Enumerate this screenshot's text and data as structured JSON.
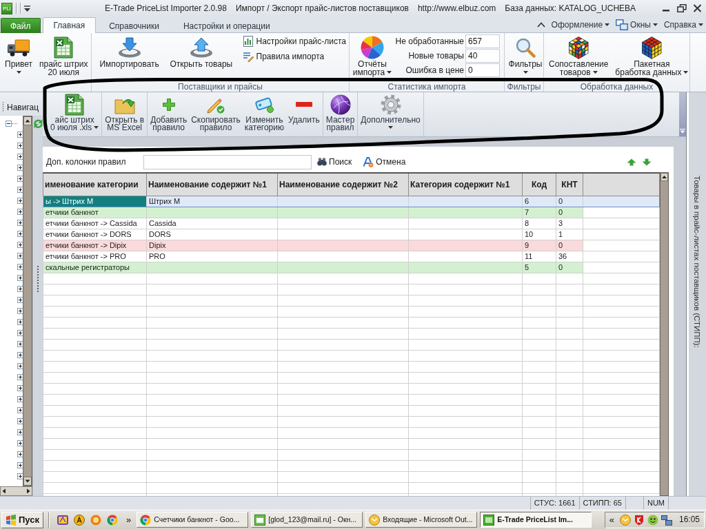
{
  "window": {
    "logo": "PLi",
    "app_title": "E-Trade PriceList Importer 2.0.98",
    "subtitle": "Импорт / Экспорт прайс-листов поставщиков",
    "url": "http://www.elbuz.com",
    "database": "База данных: KATALOG_UCHEBA"
  },
  "ribbon_tabs": [
    {
      "label": "Файл",
      "kind": "file",
      "selected": false
    },
    {
      "label": "Главная",
      "kind": "tab",
      "selected": true
    },
    {
      "label": "Справочники",
      "kind": "tab",
      "selected": false
    },
    {
      "label": "Настройки и операции",
      "kind": "tab",
      "selected": false
    }
  ],
  "ribbon_menus": [
    {
      "label": "Оформление"
    },
    {
      "label": "Окны"
    },
    {
      "label": "Справка"
    }
  ],
  "ribbon_groups": [
    {
      "large_buttons": [
        {
          "lines": [
            "Привет"
          ],
          "dropdown": true
        },
        {
          "lines": [
            "прайс штрих",
            "20 июля"
          ],
          "dropdown": false
        }
      ]
    },
    {
      "title": "Поставщики и прайсы",
      "large_buttons": [
        {
          "lines": [
            "Импортировать"
          ],
          "dropdown": false
        },
        {
          "lines": [
            "Открыть товары"
          ],
          "dropdown": false
        }
      ],
      "small_buttons": [
        "Настройки прайс-листа",
        "Правила импорта"
      ]
    },
    {
      "title": "Статистика импорта",
      "large_buttons": [
        {
          "lines": [
            "Отчёты",
            "импорта"
          ],
          "dropdown": true
        }
      ],
      "stats": [
        {
          "label": "Не обработанные",
          "value": "657"
        },
        {
          "label": "Новые товары",
          "value": "40"
        },
        {
          "label": "Ошибка в цене",
          "value": "0"
        }
      ]
    },
    {
      "title": "Фильтры",
      "large_buttons": [
        {
          "lines": [
            "Фильтры"
          ],
          "dropdown": true
        }
      ]
    },
    {
      "title": "Обработка данных",
      "large_buttons": [
        {
          "lines": [
            "Сопоставление",
            "товаров"
          ],
          "dropdown": true
        },
        {
          "lines": [
            "Пакетная",
            "бработка данных"
          ],
          "dropdown": true
        }
      ]
    }
  ],
  "navigation": {
    "title": "Навигац",
    "tree": [
      {
        "expanded": true,
        "children": [
          {
            "expanded": false
          },
          {
            "expanded": false
          },
          {
            "expanded": false
          },
          {
            "expanded": false
          },
          {
            "expanded": false
          },
          {
            "expanded": false
          },
          {
            "expanded": false
          },
          {
            "expanded": false
          },
          {
            "expanded": false
          },
          {
            "expanded": false
          },
          {
            "expanded": false
          },
          {
            "expanded": false
          },
          {
            "expanded": false
          },
          {
            "expanded": false
          },
          {
            "expanded": false
          },
          {
            "expanded": false
          },
          {
            "expanded": false
          },
          {
            "expanded": false
          },
          {
            "expanded": false
          },
          {
            "expanded": false
          },
          {
            "expanded": false
          },
          {
            "expanded": false
          },
          {
            "expanded": false
          },
          {
            "expanded": false
          },
          {
            "expanded": false
          },
          {
            "expanded": false
          },
          {
            "expanded": false
          },
          {
            "expanded": false
          },
          {
            "expanded": false
          },
          {
            "expanded": false
          },
          {
            "expanded": false
          },
          {
            "expanded": false
          }
        ]
      }
    ]
  },
  "toolbar": {
    "groups": [
      [
        {
          "lines": [
            "айс штрих",
            "0 июля .xls"
          ],
          "dropdown": true
        }
      ],
      [
        {
          "lines": [
            "Открыть в",
            "MS Excel"
          ],
          "dropdown": false
        }
      ],
      [
        {
          "lines": [
            "Добавить",
            "правило"
          ],
          "dropdown": false
        },
        {
          "lines": [
            "Скопировать",
            "правило"
          ],
          "dropdown": false
        },
        {
          "lines": [
            "Изменить",
            "категорию"
          ],
          "dropdown": false
        },
        {
          "lines": [
            "Удалить"
          ],
          "dropdown": false
        }
      ],
      [
        {
          "lines": [
            "Мастер",
            "правил"
          ],
          "dropdown": false
        }
      ],
      [
        {
          "lines": [
            "Дополнительно"
          ],
          "dropdown": true
        }
      ]
    ]
  },
  "filter_bar": {
    "label": "Доп. колонки правил",
    "search": "Поиск",
    "cancel": "Отмена"
  },
  "table": {
    "columns": [
      "именование категории",
      "Наименование содержит №1",
      "Наименование содержит №2",
      "Категория содержит №1",
      "Код",
      "КНТ"
    ],
    "rows": [
      {
        "cells": [
          "ы -> Штрих М",
          "Штрих М",
          "",
          "",
          "6",
          "0"
        ],
        "selected": true
      },
      {
        "cells": [
          "етчики банкнот",
          "",
          "",
          "",
          "7",
          "0"
        ],
        "selected": false,
        "color": "#d3f1d0"
      },
      {
        "cells": [
          "етчики банкнот -> Cassida",
          "Cassida",
          "",
          "",
          "8",
          "3"
        ],
        "selected": false
      },
      {
        "cells": [
          "етчики банкнот -> DORS",
          "DORS",
          "",
          "",
          "10",
          "1"
        ],
        "selected": false
      },
      {
        "cells": [
          "етчики банкнот -> Dipix",
          "Dipix",
          "",
          "",
          "9",
          "0"
        ],
        "selected": false,
        "color": "#fadada"
      },
      {
        "cells": [
          "етчики банкнот -> PRO",
          "PRO",
          "",
          "",
          "11",
          "36"
        ],
        "selected": false
      },
      {
        "cells": [
          "скальные регистраторы",
          "",
          "",
          "",
          "5",
          "0"
        ],
        "selected": false,
        "color": "#d3f1d0"
      }
    ]
  },
  "side_panel": {
    "title": "Товары в прайс-листах поставщиков (СТИПП):"
  },
  "status_bar": [
    "СТУС: 1661",
    "СТИПП: 65",
    "NUM"
  ],
  "taskbar": {
    "start": "Пуск",
    "more": "»",
    "tasks": [
      {
        "label": "Счетчики банкнот - Goo...",
        "selected": false
      },
      {
        "label": "[glod_123@mail.ru] - Окн...",
        "selected": false
      },
      {
        "label": "Входящие - Microsoft Out...",
        "selected": false
      },
      {
        "label": "E-Trade PriceList Im...",
        "selected": true
      }
    ],
    "tray_more": "«",
    "clock": "16:05"
  }
}
